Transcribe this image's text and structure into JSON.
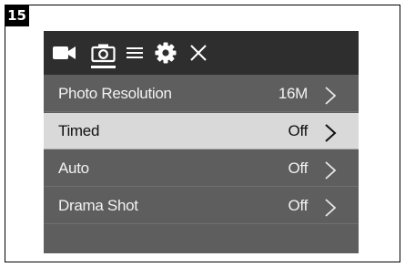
{
  "figure": {
    "step_number": "15"
  },
  "toolbar": {
    "icons": [
      {
        "name": "video-camera-icon",
        "active": false
      },
      {
        "name": "photo-camera-icon",
        "active": true
      },
      {
        "name": "menu-list-icon",
        "active": false
      },
      {
        "name": "settings-gear-icon",
        "active": false
      },
      {
        "name": "close-icon",
        "active": false
      }
    ]
  },
  "menu": {
    "items": [
      {
        "label": "Photo Resolution",
        "value": "16M",
        "selected": false
      },
      {
        "label": "Timed",
        "value": "Off",
        "selected": true
      },
      {
        "label": "Auto",
        "value": "Off",
        "selected": false
      },
      {
        "label": "Drama Shot",
        "value": "Off",
        "selected": false
      }
    ]
  },
  "colors": {
    "toolbar_bg": "#2e2e2e",
    "menu_bg": "#5e5e5e",
    "selected_row_bg": "#d9d9d9",
    "text_light": "#f2f2f2",
    "text_dark": "#111111"
  }
}
